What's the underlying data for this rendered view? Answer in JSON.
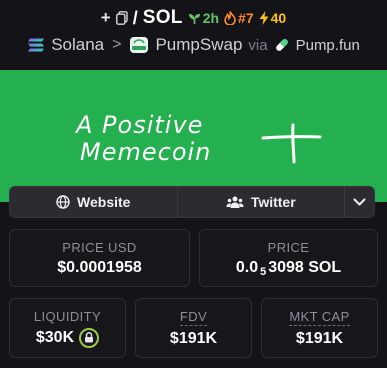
{
  "header": {
    "add_label": "+",
    "slash": "/",
    "symbol": "SOL",
    "age": "2h",
    "rank": "#7",
    "boosts": "40"
  },
  "route": {
    "chain": "Solana",
    "separator": ">",
    "dex": "PumpSwap",
    "via_label": "via",
    "launchpad": "Pump.fun"
  },
  "banner": {
    "handwriting_line1": "A Positive",
    "handwriting_line2": "Memecoin",
    "background": "#24b04e"
  },
  "links": {
    "website_label": "Website",
    "twitter_label": "Twitter"
  },
  "stats": {
    "price_usd": {
      "label": "PRICE USD",
      "value": "$0.0001958"
    },
    "price_native": {
      "label": "PRICE",
      "prefix": "0.0",
      "zeros": "5",
      "suffix": "3098 SOL"
    },
    "liquidity": {
      "label": "LIQUIDITY",
      "value": "$30K"
    },
    "fdv": {
      "label": "FDV",
      "value": "$191K"
    },
    "mkt_cap": {
      "label": "MKT CAP",
      "value": "$191K"
    }
  },
  "colors": {
    "accent_green": "#65c466",
    "rank_orange": "#ff8a25",
    "boost_yellow": "#ffc01e",
    "lock_ring": "#9ccc4a"
  }
}
